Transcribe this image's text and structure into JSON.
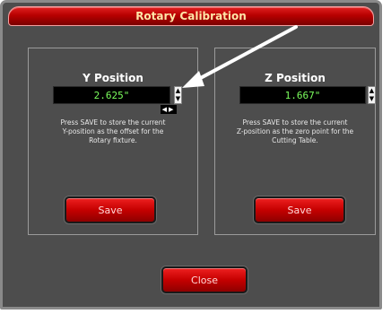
{
  "window": {
    "title": "Rotary Calibration"
  },
  "y_panel": {
    "title": "Y Position",
    "value": "2.625\"",
    "instructions": "Press SAVE to store the current\nY-position as the offset for the\nRotary fixture.",
    "save_label": "Save"
  },
  "z_panel": {
    "title": "Z Position",
    "value": "1.667\"",
    "instructions": "Press SAVE to store the current\nZ-position as the zero point for the\nCutting Table.",
    "save_label": "Save"
  },
  "footer": {
    "close_label": "Close"
  },
  "icons": {
    "spin_up": "▲",
    "spin_down": "▼",
    "jog_arrows": "◀▶"
  },
  "colors": {
    "accent_red": "#c50000",
    "readout_green": "#7cff5e",
    "background": "#4d4d4d"
  }
}
